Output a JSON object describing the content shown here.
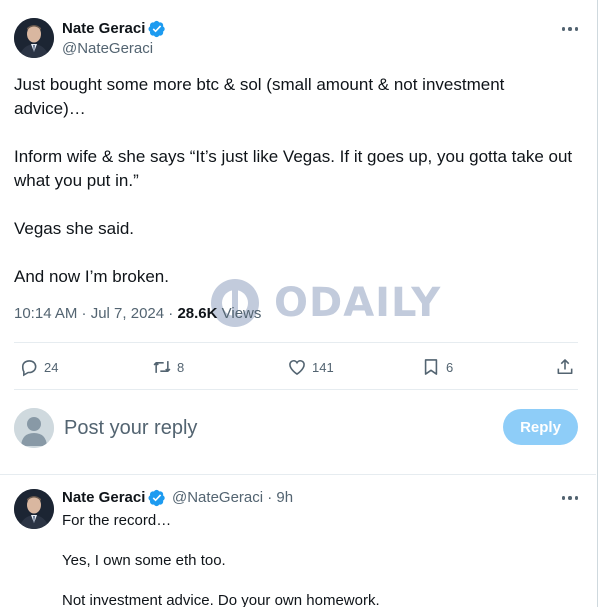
{
  "main_tweet": {
    "author_name": "Nate Geraci",
    "author_handle": "@NateGeraci",
    "text": [
      "Just bought some more btc & sol (small amount & not investment advice)…",
      "Inform wife & she says “It’s just like Vegas. If it goes up, you gotta take out what you put in.”",
      "Vegas she said.",
      "And now I’m broken."
    ],
    "time": "10:14 AM · Jul 7, 2024 · ",
    "views_count": "28.6K",
    "views_label": " Views",
    "actions": {
      "replies": "24",
      "reposts": "8",
      "likes": "141",
      "bookmarks": "6"
    }
  },
  "watermark": {
    "text": "ODAILY"
  },
  "reply_box": {
    "placeholder": "Post your reply",
    "button_label": "Reply"
  },
  "reply_tweet": {
    "author_name": "Nate Geraci",
    "author_handle": "@NateGeraci",
    "age": " · 9h",
    "text": [
      "For the record…",
      "Yes, I own some eth too.",
      "Not investment advice. Do your own homework."
    ]
  },
  "colors": {
    "verified": "#1d9bf0",
    "reply_button": "#8ecdf8",
    "secondary_text": "#536471",
    "watermark": "#b8c2d6"
  },
  "icons": [
    "avatar",
    "verified-badge-icon",
    "more-icon",
    "reply-icon",
    "repost-icon",
    "like-icon",
    "bookmark-icon",
    "share-icon",
    "odaily-logo-icon"
  ]
}
